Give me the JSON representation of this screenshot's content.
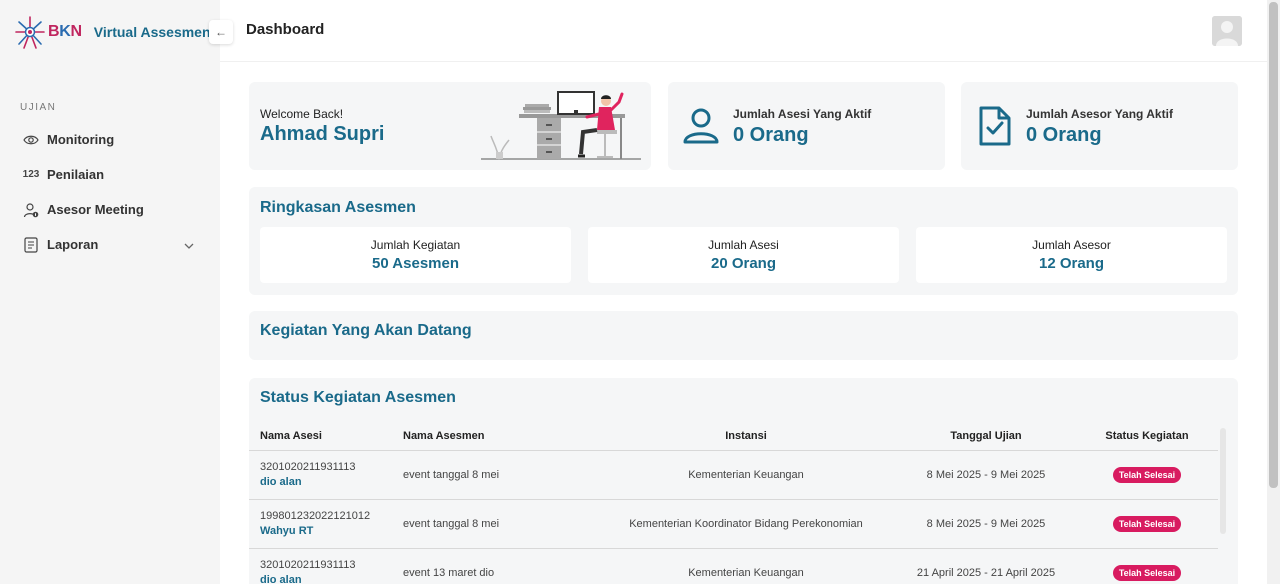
{
  "brand": {
    "logo_text_a": "B",
    "logo_text_b": "K",
    "logo_text_c": "N",
    "app_name": "Virtual Assesment"
  },
  "sidebar": {
    "section": "UJIAN",
    "items": [
      {
        "label": "Monitoring",
        "icon": "eye-icon"
      },
      {
        "label": "Penilaian",
        "icon": "numbers-icon",
        "icon_text": "123"
      },
      {
        "label": "Asesor Meeting",
        "icon": "user-info-icon"
      },
      {
        "label": "Laporan",
        "icon": "report-icon"
      }
    ]
  },
  "header": {
    "title": "Dashboard",
    "collapse_icon": "←"
  },
  "welcome": {
    "greeting": "Welcome Back!",
    "name": "Ahmad Supri"
  },
  "stats": [
    {
      "label": "Jumlah Asesi Yang Aktif",
      "value": "0 Orang",
      "icon": "user-icon"
    },
    {
      "label": "Jumlah Asesor Yang Aktif",
      "value": "0 Orang",
      "icon": "document-check-icon"
    }
  ],
  "ringkasan": {
    "title": "Ringkasan Asesmen",
    "boxes": [
      {
        "label": "Jumlah Kegiatan",
        "value": "50 Asesmen"
      },
      {
        "label": "Jumlah Asesi",
        "value": "20 Orang"
      },
      {
        "label": "Jumlah Asesor",
        "value": "12 Orang"
      }
    ]
  },
  "upcoming": {
    "title": "Kegiatan Yang Akan Datang"
  },
  "status": {
    "title": "Status Kegiatan Asesmen",
    "columns": [
      "Nama Asesi",
      "Nama Asesmen",
      "Instansi",
      "Tanggal Ujian",
      "Status Kegiatan"
    ],
    "rows": [
      {
        "nip": "3201020211931113",
        "name": "dio alan",
        "asesmen": "event tanggal 8 mei",
        "instansi": "Kementerian Keuangan",
        "tanggal": "8 Mei 2025 - 9 Mei 2025",
        "status": "Telah Selesai"
      },
      {
        "nip": "199801232022121012",
        "name": "Wahyu RT",
        "asesmen": "event tanggal 8 mei",
        "instansi": "Kementerian Koordinator Bidang Perekonomian",
        "tanggal": "8 Mei 2025 - 9 Mei 2025",
        "status": "Telah Selesai"
      },
      {
        "nip": "3201020211931113",
        "name": "dio alan",
        "asesmen": "event 13 maret dio",
        "instansi": "Kementerian Keuangan",
        "tanggal": "21 April 2025 - 21 April 2025",
        "status": "Telah Selesai"
      }
    ]
  },
  "colors": {
    "primary": "#1a6a8a",
    "badge": "#d81b60",
    "brand_pink": "#c0265f",
    "brand_blue": "#2a6bb0"
  }
}
